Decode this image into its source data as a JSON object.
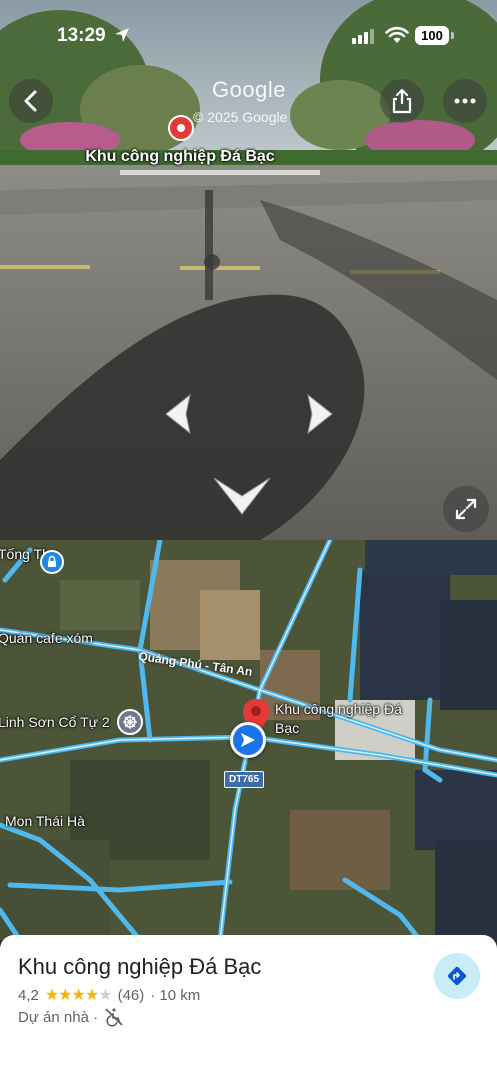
{
  "status_bar": {
    "time": "13:29",
    "battery": "100"
  },
  "street_view": {
    "brand": "Google",
    "copyright": "© 2025 Google",
    "place_label": "Khu công nghiệp Đá Bạc"
  },
  "map": {
    "labels": {
      "tong_tho": "Tống Thơ",
      "cafe": "Quán cafe xóm",
      "linh_son": "Linh Sơn Cổ Tự 2",
      "mon_thai_ha": "Mon Thái Hà",
      "place": "Khu công nghiệp Đá Bạc",
      "road": "Quảng Phú - Tân An",
      "route_shield": "DT765"
    }
  },
  "place_sheet": {
    "name": "Khu công nghiệp Đá Bạc",
    "rating": "4,2",
    "stars": 4,
    "review_count": "(46)",
    "distance": "· 10 km",
    "category": "Dự án nhà ·"
  },
  "icons": {
    "back": "chevron-left-icon",
    "share": "share-icon",
    "more": "more-horizontal-icon",
    "expand": "expand-icon",
    "directions": "directions-icon",
    "accessibility": "no-wheelchair-icon"
  },
  "colors": {
    "pin": "#e53935",
    "road": "#4fb8ec",
    "directions_bg": "#c9ecf7"
  }
}
